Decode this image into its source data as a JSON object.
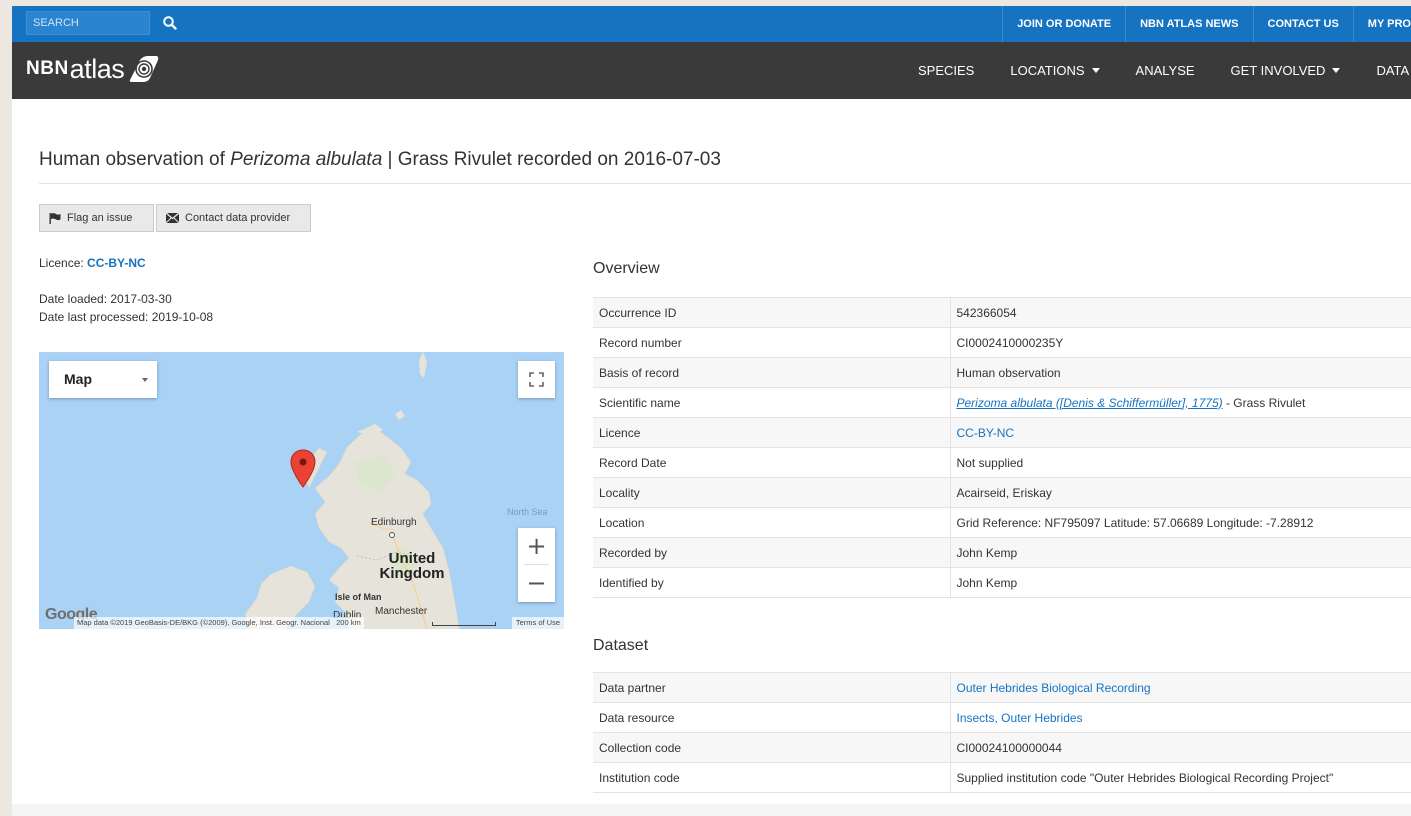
{
  "topbar": {
    "search_placeholder": "SEARCH",
    "links": [
      "JOIN OR DONATE",
      "NBN ATLAS NEWS",
      "CONTACT US",
      "MY PRO"
    ]
  },
  "navbar": {
    "logo_nbn": "NBN",
    "logo_atlas": "atlas",
    "links": [
      {
        "label": "SPECIES",
        "dropdown": false
      },
      {
        "label": "LOCATIONS",
        "dropdown": true
      },
      {
        "label": "ANALYSE",
        "dropdown": false
      },
      {
        "label": "GET INVOLVED",
        "dropdown": true
      },
      {
        "label": "DATA A",
        "dropdown": false
      }
    ]
  },
  "page": {
    "title_prefix": "Human observation of ",
    "title_species": "Perizoma albulata",
    "title_suffix": " | Grass Rivulet recorded on 2016-07-03"
  },
  "actions": {
    "flag_label": "Flag an issue",
    "contact_label": "Contact data provider"
  },
  "meta": {
    "licence_label": "Licence: ",
    "licence_value": "CC-BY-NC",
    "date_loaded": "Date loaded: 2017-03-30",
    "date_processed": "Date last processed: 2019-10-08"
  },
  "map": {
    "type_label": "Map",
    "zoom_in": "+",
    "zoom_out": "−",
    "labels": {
      "edinburgh": "Edinburgh",
      "uk_line1": "United",
      "uk_line2": "Kingdom",
      "isle_of_man": "Isle of Man",
      "manchester": "Manchester",
      "dublin": "Dublin",
      "north_sea": "North Sea"
    },
    "google": "Google",
    "attribution": "Map data ©2019 GeoBasis-DE/BKG (©2009), Google, Inst. Geogr. Nacional",
    "scale": "200 km",
    "terms": "Terms of Use"
  },
  "overview": {
    "title": "Overview",
    "rows": [
      {
        "key": "Occurrence ID",
        "value": "542366054"
      },
      {
        "key": "Record number",
        "value": "CI0002410000235Y"
      },
      {
        "key": "Basis of record",
        "value": "Human observation"
      },
      {
        "key": "Scientific name",
        "value_link": "Perizoma albulata ([Denis & Schiffermüller], 1775)",
        "value_suffix": " - Grass Rivulet"
      },
      {
        "key": "Licence",
        "value_link_plain": "CC-BY-NC"
      },
      {
        "key": "Record Date",
        "value": "Not supplied"
      },
      {
        "key": "Locality",
        "value": "Acairseid, Eriskay"
      },
      {
        "key": "Location",
        "value": "Grid Reference: NF795097 Latitude: 57.06689 Longitude: -7.28912"
      },
      {
        "key": "Recorded by",
        "value": "John Kemp"
      },
      {
        "key": "Identified by",
        "value": "John Kemp"
      }
    ]
  },
  "dataset": {
    "title": "Dataset",
    "rows": [
      {
        "key": "Data partner",
        "value_link_plain": "Outer Hebrides Biological Recording"
      },
      {
        "key": "Data resource",
        "value_link_plain": "Insects, Outer Hebrides"
      },
      {
        "key": "Collection code",
        "value": "CI00024100000044"
      },
      {
        "key": "Institution code",
        "value": "Supplied institution code \"Outer Hebrides Biological Recording Project\""
      }
    ]
  },
  "colors": {
    "topbar": "#1673c2",
    "navbar": "#3a3a3a",
    "link": "#1673c2",
    "map_water": "#a9d2f5",
    "map_land": "#e6e3da",
    "marker": "#ea4335"
  }
}
